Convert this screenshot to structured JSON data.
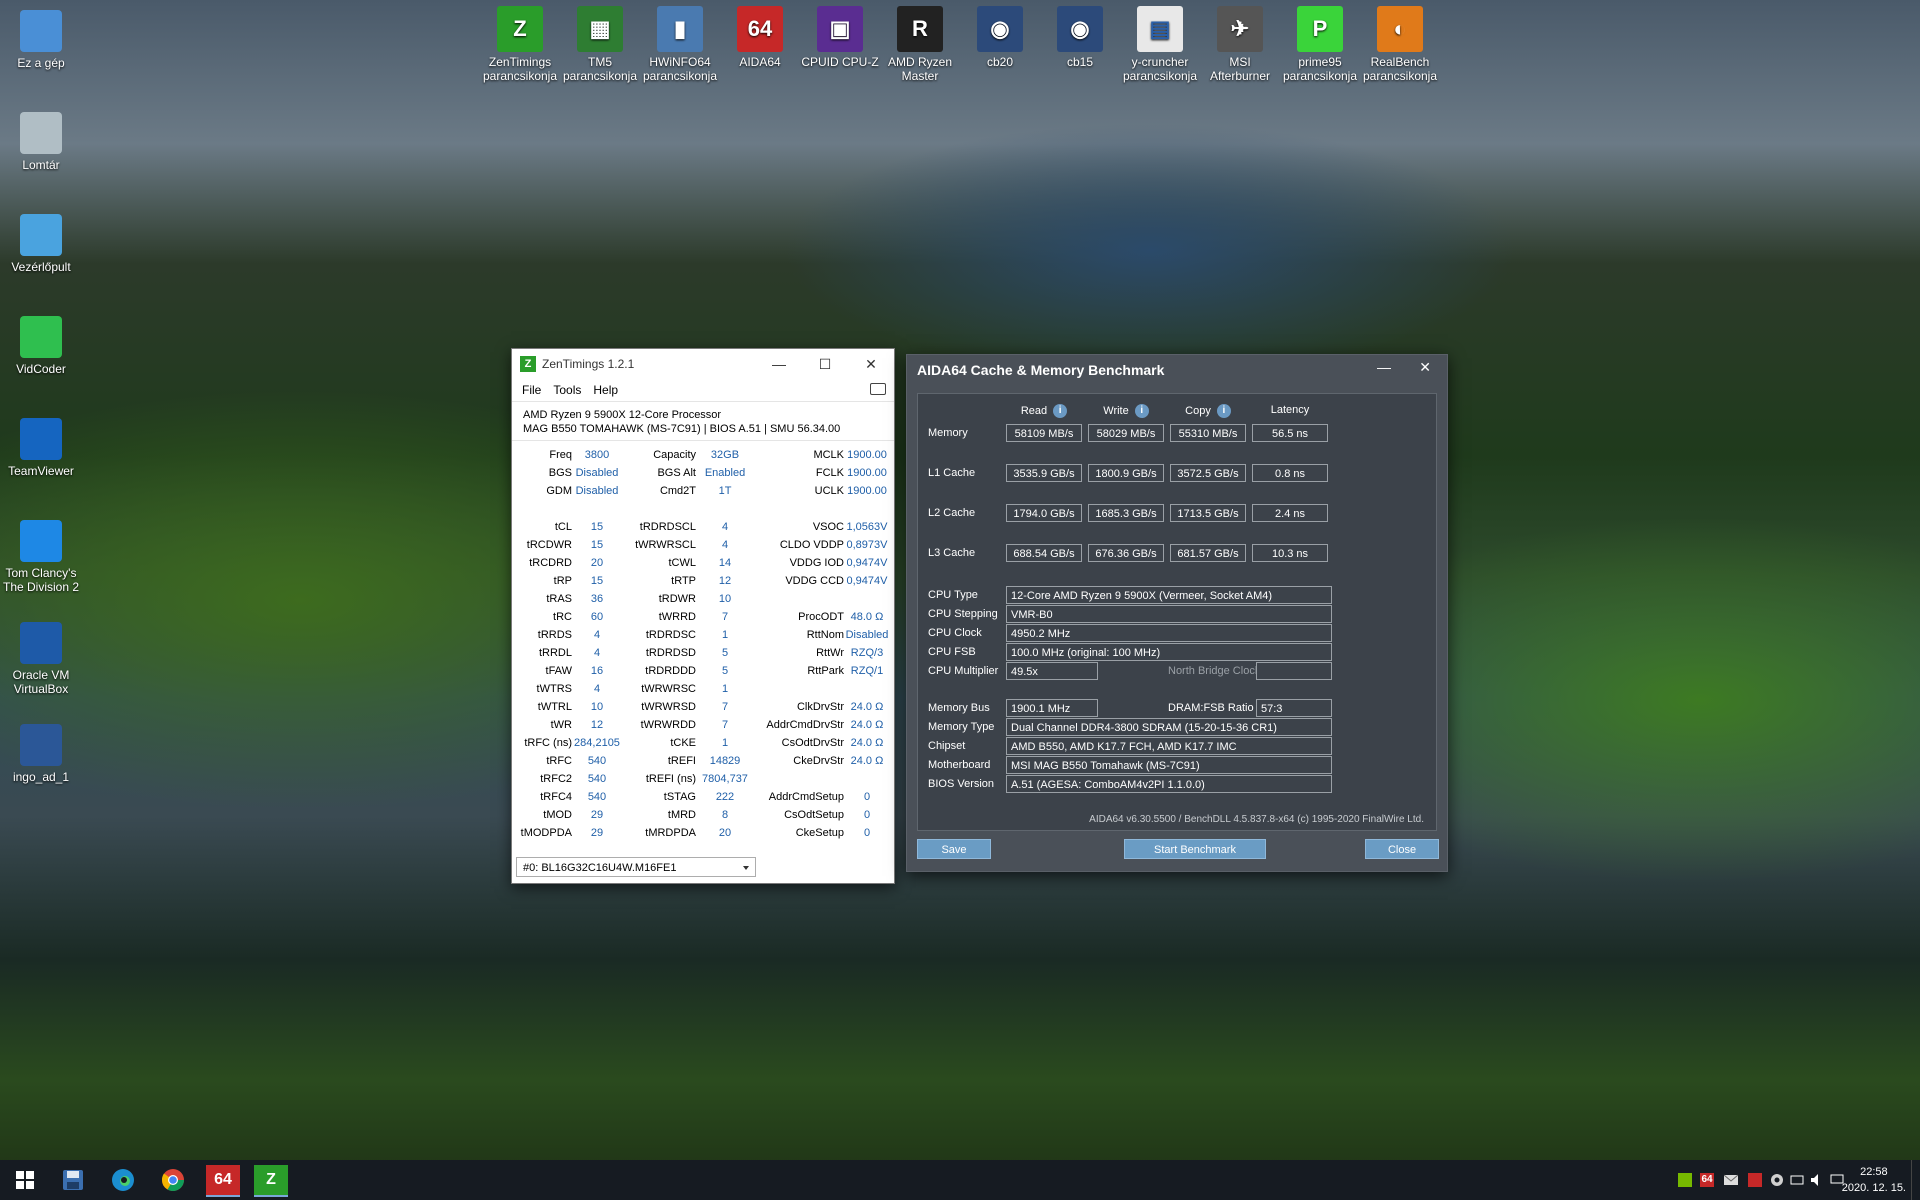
{
  "desktop_icons": [
    {
      "label": "Ez a gép",
      "icon": "computer-icon"
    },
    {
      "label": "Lomtár",
      "icon": "recycle-bin-icon"
    },
    {
      "label": "Vezérlőpult",
      "icon": "control-panel-icon"
    },
    {
      "label": "VidCoder",
      "icon": "vidcoder-icon"
    },
    {
      "label": "TeamViewer",
      "icon": "teamviewer-icon"
    },
    {
      "label": "Tom Clancy's The Division 2",
      "icon": "division-icon"
    },
    {
      "label": "Oracle VM VirtualBox",
      "icon": "virtualbox-icon"
    },
    {
      "label": "ingo_ad_1",
      "icon": "word-doc-icon"
    }
  ],
  "top_icons": [
    {
      "label": "ZenTimings parancsikonja",
      "glyph": "Z",
      "color": "#2a9d2a"
    },
    {
      "label": "TM5 parancsikonja",
      "glyph": "▦",
      "color": "#2e7d32"
    },
    {
      "label": "HWiNFO64 parancsikonja",
      "glyph": "▮",
      "color": "#4a7ab0"
    },
    {
      "label": "AIDA64",
      "glyph": "64",
      "color": "#c62828"
    },
    {
      "label": "CPUID CPU-Z",
      "glyph": "▣",
      "color": "#5a2d91"
    },
    {
      "label": "AMD Ryzen Master",
      "glyph": "R",
      "color": "#222222"
    },
    {
      "label": "cb20",
      "glyph": "◉",
      "color": "#2c4a7a"
    },
    {
      "label": "cb15",
      "glyph": "◉",
      "color": "#2c4a7a"
    },
    {
      "label": "y-cruncher parancsikonja",
      "glyph": "▤",
      "color": "#e8e8e8"
    },
    {
      "label": "MSI Afterburner",
      "glyph": "✈",
      "color": "#555555"
    },
    {
      "label": "prime95 parancsikonja",
      "glyph": "P",
      "color": "#3ad43a"
    },
    {
      "label": "RealBench parancsikonja",
      "glyph": "◐",
      "color": "#e07a1a"
    }
  ],
  "zentimings": {
    "title": "ZenTimings 1.2.1",
    "menu": [
      "File",
      "Tools",
      "Help"
    ],
    "cpu": "AMD Ryzen 9 5900X 12-Core Processor",
    "board": "MAG B550 TOMAHAWK (MS-7C91) | BIOS A.51 | SMU 56.34.00",
    "rows": [
      [
        "Freq",
        "3800",
        "Capacity",
        "32GB",
        "MCLK",
        "1900.00"
      ],
      [
        "BGS",
        "Disabled",
        "BGS Alt",
        "Enabled",
        "FCLK",
        "1900.00"
      ],
      [
        "GDM",
        "Disabled",
        "Cmd2T",
        "1T",
        "UCLK",
        "1900.00"
      ],
      [
        "",
        "",
        "",
        "",
        "",
        ""
      ],
      [
        "tCL",
        "15",
        "tRDRDSCL",
        "4",
        "VSOC",
        "1,0563V"
      ],
      [
        "tRCDWR",
        "15",
        "tWRWRSCL",
        "4",
        "CLDO VDDP",
        "0,8973V"
      ],
      [
        "tRCDRD",
        "20",
        "tCWL",
        "14",
        "VDDG IOD",
        "0,9474V"
      ],
      [
        "tRP",
        "15",
        "tRTP",
        "12",
        "VDDG CCD",
        "0,9474V"
      ],
      [
        "tRAS",
        "36",
        "tRDWR",
        "10",
        "",
        ""
      ],
      [
        "tRC",
        "60",
        "tWRRD",
        "7",
        "ProcODT",
        "48.0 Ω"
      ],
      [
        "tRRDS",
        "4",
        "tRDRDSC",
        "1",
        "RttNom",
        "Disabled"
      ],
      [
        "tRRDL",
        "4",
        "tRDRDSD",
        "5",
        "RttWr",
        "RZQ/3"
      ],
      [
        "tFAW",
        "16",
        "tRDRDDD",
        "5",
        "RttPark",
        "RZQ/1"
      ],
      [
        "tWTRS",
        "4",
        "tWRWRSC",
        "1",
        "",
        ""
      ],
      [
        "tWTRL",
        "10",
        "tWRWRSD",
        "7",
        "ClkDrvStr",
        "24.0 Ω"
      ],
      [
        "tWR",
        "12",
        "tWRWRDD",
        "7",
        "AddrCmdDrvStr",
        "24.0 Ω"
      ],
      [
        "tRFC (ns)",
        "284,2105",
        "tCKE",
        "1",
        "CsOdtDrvStr",
        "24.0 Ω"
      ],
      [
        "tRFC",
        "540",
        "tREFI",
        "14829",
        "CkeDrvStr",
        "24.0 Ω"
      ],
      [
        "tRFC2",
        "540",
        "tREFI (ns)",
        "7804,737",
        "",
        ""
      ],
      [
        "tRFC4",
        "540",
        "tSTAG",
        "222",
        "AddrCmdSetup",
        "0"
      ],
      [
        "tMOD",
        "29",
        "tMRD",
        "8",
        "CsOdtSetup",
        "0"
      ],
      [
        "tMODPDA",
        "29",
        "tMRDPDA",
        "20",
        "CkeSetup",
        "0"
      ]
    ],
    "module": "#0: BL16G32C16U4W.M16FE1"
  },
  "aida": {
    "title": "AIDA64 Cache & Memory Benchmark",
    "headers": [
      "Read",
      "Write",
      "Copy",
      "Latency"
    ],
    "bench": [
      {
        "label": "Memory",
        "values": [
          "58109 MB/s",
          "58029 MB/s",
          "55310 MB/s",
          "56.5 ns"
        ]
      },
      {
        "label": "L1 Cache",
        "values": [
          "3535.9 GB/s",
          "1800.9 GB/s",
          "3572.5 GB/s",
          "0.8 ns"
        ]
      },
      {
        "label": "L2 Cache",
        "values": [
          "1794.0 GB/s",
          "1685.3 GB/s",
          "1713.5 GB/s",
          "2.4 ns"
        ]
      },
      {
        "label": "L3 Cache",
        "values": [
          "688.54 GB/s",
          "676.36 GB/s",
          "681.57 GB/s",
          "10.3 ns"
        ]
      }
    ],
    "info1": [
      {
        "label": "CPU Type",
        "value": "12-Core AMD Ryzen 9 5900X  (Vermeer, Socket AM4)"
      },
      {
        "label": "CPU Stepping",
        "value": "VMR-B0"
      },
      {
        "label": "CPU Clock",
        "value": "4950.2 MHz"
      },
      {
        "label": "CPU FSB",
        "value": "100.0 MHz  (original: 100 MHz)"
      }
    ],
    "cpu_multiplier_label": "CPU Multiplier",
    "cpu_multiplier": "49.5x",
    "nb_clock_label": "North Bridge Clock",
    "nb_clock": "",
    "memory_bus_label": "Memory Bus",
    "memory_bus": "1900.1 MHz",
    "dram_fsb_label": "DRAM:FSB Ratio",
    "dram_fsb": "57:3",
    "info2": [
      {
        "label": "Memory Type",
        "value": "Dual Channel DDR4-3800 SDRAM  (15-20-15-36 CR1)"
      },
      {
        "label": "Chipset",
        "value": "AMD B550, AMD K17.7 FCH, AMD K17.7 IMC"
      },
      {
        "label": "Motherboard",
        "value": "MSI MAG B550 Tomahawk (MS-7C91)"
      },
      {
        "label": "BIOS Version",
        "value": "A.51  (AGESA: ComboAM4v2PI 1.1.0.0)"
      }
    ],
    "footer": "AIDA64 v6.30.5500 / BenchDLL 4.5.837.8-x64  (c) 1995-2020 FinalWire Ltd.",
    "save": "Save",
    "start": "Start Benchmark",
    "close": "Close"
  },
  "taskbar": {
    "aida_glyph": "64",
    "zen_glyph": "Z",
    "tray_badge": "64",
    "time": "22:58",
    "date": "2020. 12. 15."
  }
}
